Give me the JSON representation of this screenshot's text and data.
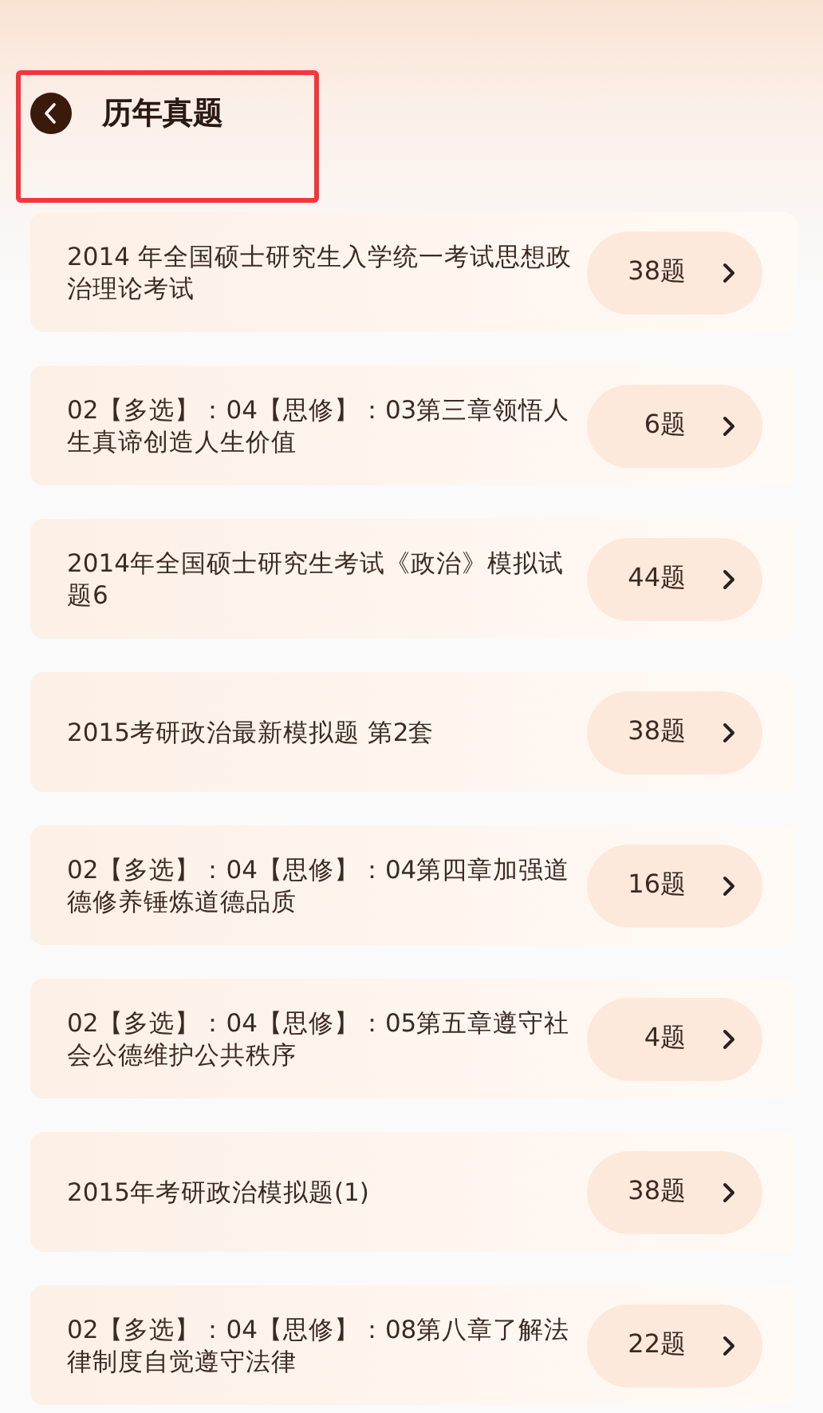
{
  "header": {
    "title": "历年真题"
  },
  "papers": [
    {
      "title": "2014 年全国硕士研究生入学统一考试思想政治理论考试",
      "count": "38题"
    },
    {
      "title": "02【多选】：04【思修】：03第三章领悟人生真谛创造人生价值",
      "count": "6题"
    },
    {
      "title": "2014年全国硕士研究生考试《政治》模拟试题6",
      "count": "44题"
    },
    {
      "title": "2015考研政治最新模拟题 第2套",
      "count": "38题"
    },
    {
      "title": "02【多选】：04【思修】：04第四章加强道德修养锤炼道德品质",
      "count": "16题"
    },
    {
      "title": "02【多选】：04【思修】：05第五章遵守社会公德维护公共秩序",
      "count": "4题"
    },
    {
      "title": "2015年考研政治模拟题(1)",
      "count": "38题"
    },
    {
      "title": "02【多选】：04【思修】：08第八章了解法律制度自觉遵守法律",
      "count": "22题"
    }
  ]
}
